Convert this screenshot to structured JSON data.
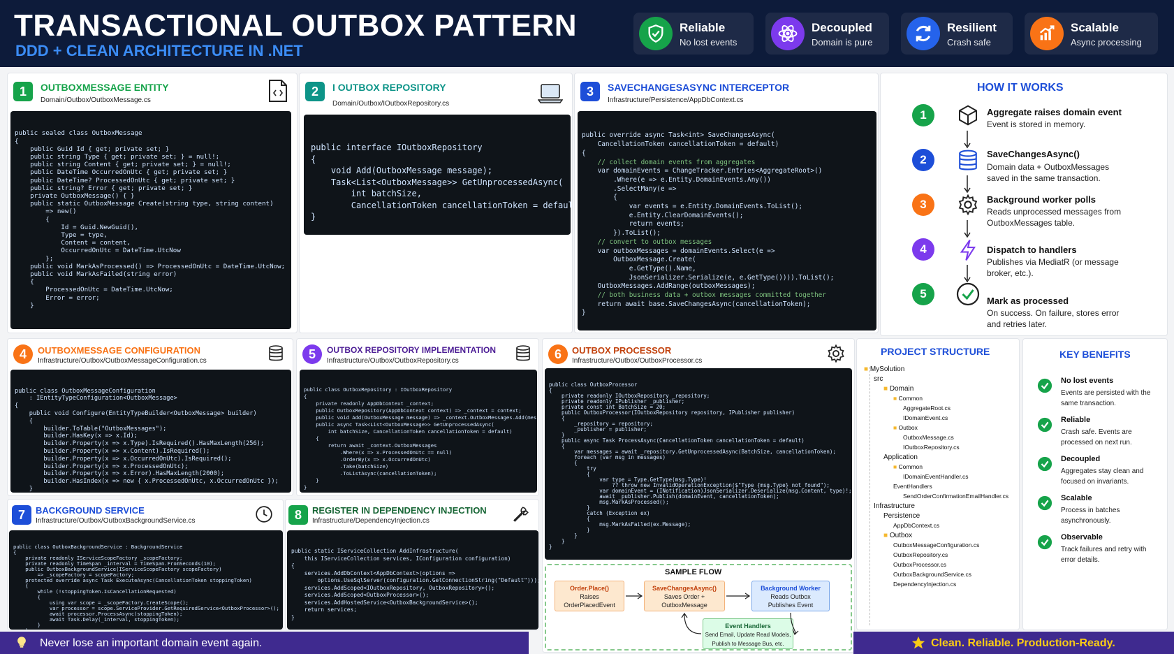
{
  "header": {
    "title": "TRANSACTIONAL OUTBOX PATTERN",
    "subtitle": "DDD + CLEAN ARCHITECTURE IN .NET",
    "badges": [
      {
        "title": "Reliable",
        "subtitle": "No lost events",
        "icon": "shield-check-icon",
        "color": "#16a34a"
      },
      {
        "title": "Decoupled",
        "subtitle": "Domain is pure",
        "icon": "atom-icon",
        "color": "#7c3aed"
      },
      {
        "title": "Resilient",
        "subtitle": "Crash safe",
        "icon": "refresh-icon",
        "color": "#2563eb"
      },
      {
        "title": "Scalable",
        "subtitle": "Async processing",
        "icon": "growth-chart-icon",
        "color": "#f97316"
      }
    ]
  },
  "cards": {
    "c1": {
      "num": "1",
      "title": "OUTBOXMESSAGE ENTITY",
      "path": "Domain/Outbox/OutboxMessage.cs",
      "icon": "file-code-icon",
      "color": "#16a34a",
      "code": [
        "public sealed class OutboxMessage",
        "{",
        "    public Guid Id { get; private set; }",
        "    public string Type { get; private set; } = null!;",
        "    public string Content { get; private set; } = null!;",
        "    public DateTime OccurredOnUtc { get; private set; }",
        "    public DateTime? ProcessedOnUtc { get; private set; }",
        "    public string? Error { get; private set; }",
        "",
        "    private OutboxMessage() { }",
        "",
        "    public static OutboxMessage Create(string type, string content)",
        "        => new()",
        "        {",
        "            Id = Guid.NewGuid(),",
        "            Type = type,",
        "            Content = content,",
        "            OccurredOnUtc = DateTime.UtcNow",
        "        };",
        "",
        "    public void MarkAsProcessed() => ProcessedOnUtc = DateTime.UtcNow;",
        "",
        "    public void MarkAsFailed(string error)",
        "    {",
        "        ProcessedOnUtc = DateTime.UtcNow;",
        "        Error = error;",
        "    }"
      ]
    },
    "c2": {
      "num": "2",
      "title": "I OUTBOX REPOSITORY",
      "path": "Domain/Outbox/IOutboxRepository.cs",
      "icon": "laptop-icon",
      "color": "#0d9488",
      "code": [
        "public interface IOutboxRepository",
        "{",
        "    void Add(OutboxMessage message);",
        "",
        "    Task<List<OutboxMessage>> GetUnprocessedAsync(",
        "        int batchSize,",
        "        CancellationToken cancellationToken = default);",
        "}"
      ]
    },
    "c3": {
      "num": "3",
      "title": "SAVECHANGESASYNC INTERCEPTOR",
      "path": "Infrastructure/Persistence/AppDbContext.cs",
      "color": "#1d4ed8",
      "code": [
        "public override async Task<int> SaveChangesAsync(",
        "    CancellationToken cancellationToken = default)",
        "{",
        "    // collect domain events from aggregates",
        "    var domainEvents = ChangeTracker.Entries<AggregateRoot>()",
        "        .Where(e => e.Entity.DomainEvents.Any())",
        "        .SelectMany(e =>",
        "        {",
        "            var events = e.Entity.DomainEvents.ToList();",
        "            e.Entity.ClearDomainEvents();",
        "            return events;",
        "        }).ToList();",
        "",
        "    // convert to outbox messages",
        "    var outboxMessages = domainEvents.Select(e =>",
        "        OutboxMessage.Create(",
        "            e.GetType().Name,",
        "            JsonSerializer.Serialize(e, e.GetType()))).ToList();",
        "",
        "    OutboxMessages.AddRange(outboxMessages);",
        "",
        "    // both business data + outbox messages committed together",
        "    return await base.SaveChangesAsync(cancellationToken);",
        "}"
      ]
    },
    "c4": {
      "num": "4",
      "title": "OUTBOXMESSAGE CONFIGURATION",
      "path": "Infrastructure/Outbox/OutboxMessageConfiguration.cs",
      "icon": "database-icon",
      "color": "#f97316",
      "code": [
        "public class OutboxMessageConfiguration",
        "    : IEntityTypeConfiguration<OutboxMessage>",
        "{",
        "    public void Configure(EntityTypeBuilder<OutboxMessage> builder)",
        "    {",
        "        builder.ToTable(\"OutboxMessages\");",
        "        builder.HasKey(x => x.Id);",
        "",
        "        builder.Property(x => x.Type).IsRequired().HasMaxLength(256);",
        "        builder.Property(x => x.Content).IsRequired();",
        "        builder.Property(x => x.OccurredOnUtc).IsRequired();",
        "        builder.Property(x => x.ProcessedOnUtc);",
        "        builder.Property(x => x.Error).HasMaxLength(2000);",
        "        builder.HasIndex(x => new { x.ProcessedOnUtc, x.OccurredOnUtc });",
        "    }"
      ]
    },
    "c5": {
      "num": "5",
      "title": "OUTBOX REPOSITORY IMPLEMENTATION",
      "path": "Infrastructure/Outbox/OutboxRepository.cs",
      "icon": "database-icon",
      "color": "#7c3aed",
      "code": [
        "public class OutboxRepository : IOutboxRepository",
        "{",
        "    private readonly AppDbContext _context;",
        "    public OutboxRepository(AppDbContext context) => _context = context;",
        "",
        "    public void Add(OutboxMessage message) => _context.OutboxMessages.Add(message);",
        "",
        "    public async Task<List<OutboxMessage>> GetUnprocessedAsync(",
        "        int batchSize, CancellationToken cancellationToken = default)",
        "    {",
        "        return await _context.OutboxMessages",
        "            .Where(x => x.ProcessedOnUtc == null)",
        "            .OrderBy(x => x.OccurredOnUtc)",
        "            .Take(batchSize)",
        "            .ToListAsync(cancellationToken);",
        "    }",
        "}"
      ]
    },
    "c6": {
      "num": "6",
      "title": "OUTBOX PROCESSOR",
      "path": "Infrastructure/Outbox/OutboxProcessor.cs",
      "icon": "gear-icon",
      "color": "#f97316",
      "code": [
        "public class OutboxProcessor",
        "{",
        "    private readonly IOutboxRepository _repository;",
        "    private readonly IPublisher _publisher;",
        "    private const int BatchSize = 20;",
        "",
        "    public OutboxProcessor(IOutboxRepository repository, IPublisher publisher)",
        "    {",
        "        _repository = repository;",
        "        _publisher = publisher;",
        "    }",
        "",
        "    public async Task ProcessAsync(CancellationToken cancellationToken = default)",
        "    {",
        "        var messages = await _repository.GetUnprocessedAsync(BatchSize, cancellationToken);",
        "",
        "        foreach (var msg in messages)",
        "        {",
        "            try",
        "            {",
        "                var type = Type.GetType(msg.Type)!",
        "                    ?? throw new InvalidOperationException($\"Type {msg.Type} not found\");",
        "",
        "                var domainEvent = (INotification)JsonSerializer.Deserialize(msg.Content, type)!;",
        "                await _publisher.Publish(domainEvent, cancellationToken);",
        "                msg.MarkAsProcessed();",
        "            }",
        "            catch (Exception ex)",
        "            {",
        "                msg.MarkAsFailed(ex.Message);",
        "            }",
        "        }",
        "    }",
        "}"
      ]
    },
    "c7": {
      "num": "7",
      "title": "BACKGROUND SERVICE",
      "path": "Infrastructure/Outbox/OutboxBackgroundService.cs",
      "icon": "clock-icon",
      "color": "#1d4ed8",
      "code": [
        "public class OutboxBackgroundService : BackgroundService",
        "{",
        "    private readonly IServiceScopeFactory _scopeFactory;",
        "    private readonly TimeSpan _interval = TimeSpan.FromSeconds(10);",
        "    public OutboxBackgroundService(IServiceScopeFactory scopeFactory)",
        "        => _scopeFactory = scopeFactory;",
        "",
        "    protected override async Task ExecuteAsync(CancellationToken stoppingToken)",
        "    {",
        "        while (!stoppingToken.IsCancellationRequested)",
        "        {",
        "            using var scope = _scopeFactory.CreateScope();",
        "            var processor = scope.ServiceProvider.GetRequiredService<OutboxProcessor>();",
        "            await processor.ProcessAsync(stoppingToken);",
        "            await Task.Delay(_interval, stoppingToken);",
        "        }",
        "    }",
        "}"
      ]
    },
    "c8": {
      "num": "8",
      "title": "REGISTER IN DEPENDENCY INJECTION",
      "path": "Infrastructure/DependencyInjection.cs",
      "icon": "wrench-icon",
      "color": "#16a34a",
      "code": [
        "public static IServiceCollection AddInfrastructure(",
        "    this IServiceCollection services, IConfiguration configuration)",
        "{",
        "    services.AddDbContext<AppDbContext>(options =>",
        "        options.UseSqlServer(configuration.GetConnectionString(\"Default\")));",
        "",
        "    services.AddScoped<IOutboxRepository, OutboxRepository>();",
        "    services.AddScoped<OutboxProcessor>();",
        "    services.AddHostedService<OutboxBackgroundService>();",
        "",
        "    return services;",
        "}"
      ]
    }
  },
  "how": {
    "title": "HOW IT WORKS",
    "steps": [
      {
        "num": "1",
        "title": "Aggregate raises domain event",
        "desc": "Event is stored in memory.",
        "icon": "cube-icon",
        "color": "#16a34a"
      },
      {
        "num": "2",
        "title": "SaveChangesAsync()",
        "desc": "Domain data + OutboxMessages saved in the same transaction.",
        "icon": "database-icon",
        "color": "#1d4ed8"
      },
      {
        "num": "3",
        "title": "Background worker polls",
        "desc": "Reads unprocessed messages from OutboxMessages table.",
        "icon": "gear-icon",
        "color": "#f97316"
      },
      {
        "num": "4",
        "title": "Dispatch to handlers",
        "desc": "Publishes via MediatR (or message broker, etc.).",
        "icon": "lightning-icon",
        "color": "#7c3aed"
      },
      {
        "num": "5",
        "title": "Mark as processed",
        "desc": "On success. On failure, stores error and retries later.",
        "icon": "check-circle-icon",
        "color": "#16a34a"
      }
    ]
  },
  "project": {
    "title": "PROJECT STRUCTURE",
    "items": [
      {
        "label": "MySolution",
        "depth": 0,
        "folder": true
      },
      {
        "label": "src",
        "depth": 1,
        "folder": false
      },
      {
        "label": "Domain",
        "depth": 2,
        "folder": true
      },
      {
        "label": "Common",
        "depth": 3,
        "folder": true
      },
      {
        "label": "AggregateRoot.cs",
        "depth": 4,
        "folder": false
      },
      {
        "label": "IDomainEvent.cs",
        "depth": 4,
        "folder": false
      },
      {
        "label": "Outbox",
        "depth": 3,
        "folder": true
      },
      {
        "label": "OutboxMessage.cs",
        "depth": 4,
        "folder": false
      },
      {
        "label": "IOutboxRepository.cs",
        "depth": 4,
        "folder": false
      },
      {
        "label": "Application",
        "depth": 2,
        "folder": false
      },
      {
        "label": "Common",
        "depth": 3,
        "folder": true
      },
      {
        "label": "IDomainEventHandler.cs",
        "depth": 4,
        "folder": false
      },
      {
        "label": "EventHandlers",
        "depth": 3,
        "folder": false
      },
      {
        "label": "SendOrderConfirmationEmailHandler.cs",
        "depth": 4,
        "folder": false
      },
      {
        "label": "Infrastructure",
        "depth": 1,
        "folder": false
      },
      {
        "label": "Persistence",
        "depth": 2,
        "folder": false
      },
      {
        "label": "AppDbContext.cs",
        "depth": 3,
        "folder": false
      },
      {
        "label": "Outbox",
        "depth": 2,
        "folder": true
      },
      {
        "label": "OutboxMessageConfiguration.cs",
        "depth": 3,
        "folder": false
      },
      {
        "label": "OutboxRepository.cs",
        "depth": 3,
        "folder": false
      },
      {
        "label": "OutboxProcessor.cs",
        "depth": 3,
        "folder": false
      },
      {
        "label": "OutboxBackgroundService.cs",
        "depth": 3,
        "folder": false
      },
      {
        "label": "DependencyInjection.cs",
        "depth": 3,
        "folder": false
      }
    ]
  },
  "benefits": {
    "title": "KEY BENEFITS",
    "items": [
      {
        "title": "No lost events",
        "desc": "Events are persisted with the same transaction."
      },
      {
        "title": "Reliable",
        "desc": "Crash safe. Events are processed on next run."
      },
      {
        "title": "Decoupled",
        "desc": "Aggregates stay clean and focused on invariants."
      },
      {
        "title": "Scalable",
        "desc": "Process in batches asynchronously."
      },
      {
        "title": "Observable",
        "desc": "Track failures and retry with error details."
      }
    ]
  },
  "flow": {
    "title": "SAMPLE FLOW",
    "boxes": [
      {
        "title": "Order.Place()",
        "desc1": "Raises",
        "desc2": "OrderPlacedEvent"
      },
      {
        "title": "SaveChangesAsync()",
        "desc1": "Saves Order +",
        "desc2": "OutboxMessage"
      },
      {
        "title": "Background Worker",
        "desc1": "Reads Outbox",
        "desc2": "Publishes Event"
      },
      {
        "title": "Event Handlers",
        "desc1": "Send Email, Update Read Models,",
        "desc2": "Publish to Message Bus, etc."
      }
    ]
  },
  "footer": {
    "left": "Never lose an important domain event again.",
    "right": "Clean. Reliable. Production-Ready.",
    "left_icon": "lightbulb-icon",
    "right_icon": "star-icon"
  }
}
